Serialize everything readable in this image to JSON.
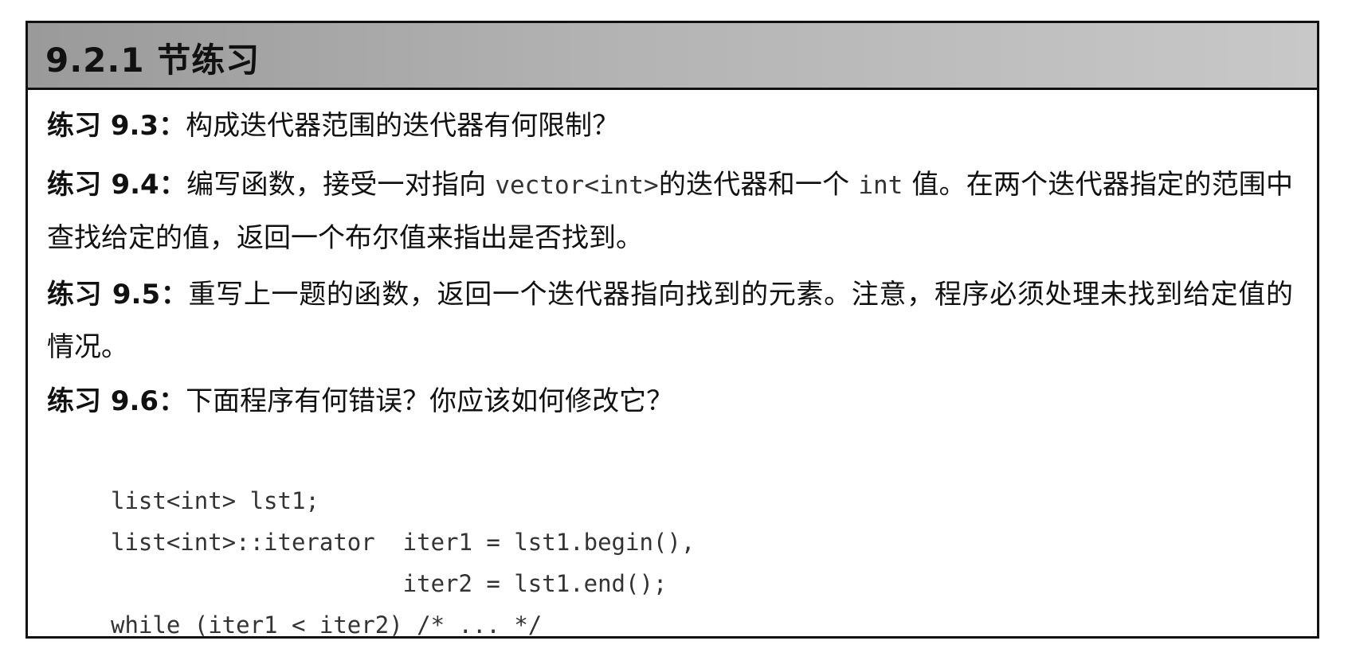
{
  "section": {
    "title": "9.2.1 节练习"
  },
  "exercises": [
    {
      "label": "练习 9.3：",
      "text": "构成迭代器范围的迭代器有何限制？"
    },
    {
      "label": "练习 9.4：",
      "text_a": "编写函数，接受一对指向 ",
      "code_a": "vector<int>",
      "text_b": "的迭代器和一个 ",
      "code_b": "int",
      "text_c": " 值。在两个迭代器指定的范围中查找给定的值，返回一个布尔值来指出是否找到。"
    },
    {
      "label": "练习 9.5：",
      "text": "重写上一题的函数，返回一个迭代器指向找到的元素。注意，程序必须处理未找到给定值的情况。"
    },
    {
      "label": "练习 9.6：",
      "text": "下面程序有何错误？你应该如何修改它？"
    }
  ],
  "code_lines": [
    "list<int> lst1;",
    "list<int>::iterator  iter1 = lst1.begin(),",
    "                     iter2 = lst1.end();",
    "while (iter1 < iter2) /* ... */"
  ]
}
